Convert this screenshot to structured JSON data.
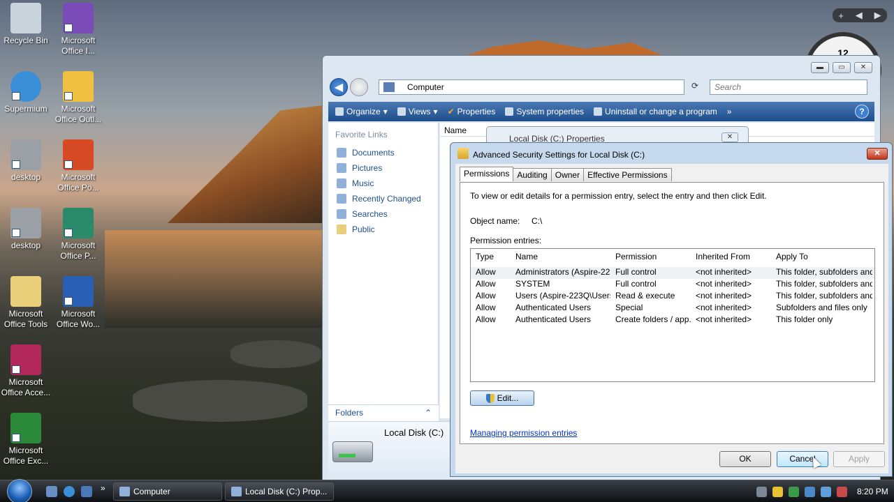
{
  "desktop": {
    "icons": [
      {
        "label": "Recycle Bin",
        "icon": "recycle-bin-icon",
        "color": "#c9d3dc"
      },
      {
        "label": "Microsoft Office I...",
        "icon": "office-infopath-icon",
        "color": "#7b4bb7"
      },
      {
        "label": "Supermium",
        "icon": "browser-globe-icon",
        "color": "#3a8fd6"
      },
      {
        "label": "Microsoft Office Outl...",
        "icon": "outlook-icon",
        "color": "#f0c040"
      },
      {
        "label": "desktop",
        "icon": "settings-gear-icon",
        "color": "#9aa0a6"
      },
      {
        "label": "Microsoft Office Po...",
        "icon": "powerpoint-icon",
        "color": "#d64a26"
      },
      {
        "label": "desktop",
        "icon": "settings-gear-icon",
        "color": "#9aa0a6"
      },
      {
        "label": "Microsoft Office P...",
        "icon": "publisher-icon",
        "color": "#2a8a6a"
      },
      {
        "label": "Microsoft Office Tools",
        "icon": "folder-icon",
        "color": "#e9cf79"
      },
      {
        "label": "Microsoft Office Wo...",
        "icon": "word-icon",
        "color": "#2b5fb4"
      },
      {
        "label": "Microsoft Office Acce...",
        "icon": "access-icon",
        "color": "#b2285b"
      },
      {
        "label": "Microsoft Office Exc...",
        "icon": "excel-icon",
        "color": "#2a8a3a"
      }
    ],
    "clock_gadget": "12",
    "gadget_controls": [
      "+",
      "◀",
      "▶"
    ]
  },
  "explorer": {
    "title_buttons": [
      "▬",
      "▭",
      "✕"
    ],
    "address": "Computer",
    "search_placeholder": "Search",
    "toolbar": {
      "organize": "Organize",
      "views": "Views",
      "properties": "Properties",
      "system_properties": "System properties",
      "uninstall": "Uninstall or change a program",
      "more": "»",
      "help": "?"
    },
    "favorite_links_title": "Favorite Links",
    "favorite_links": [
      "Documents",
      "Pictures",
      "Music",
      "Recently Changed",
      "Searches",
      "Public"
    ],
    "folders_label": "Folders",
    "column_name": "Name",
    "details_name": "Local Disk (C:)"
  },
  "properties_dialog": {
    "title": "Local Disk (C:) Properties"
  },
  "security_dialog": {
    "title": "Advanced Security Settings for Local Disk (C:)",
    "close": "✕",
    "tabs": [
      "Permissions",
      "Auditing",
      "Owner",
      "Effective Permissions"
    ],
    "instructions": "To view or edit details for a permission entry, select the entry and then click Edit.",
    "object_name_label": "Object name:",
    "object_name_value": "C:\\",
    "entries_label": "Permission entries:",
    "columns": [
      "Type",
      "Name",
      "Permission",
      "Inherited From",
      "Apply To"
    ],
    "rows": [
      {
        "type": "Allow",
        "name": "Administrators (Aspire-223...",
        "permission": "Full control",
        "inherited": "<not inherited>",
        "apply": "This folder, subfolders and..."
      },
      {
        "type": "Allow",
        "name": "SYSTEM",
        "permission": "Full control",
        "inherited": "<not inherited>",
        "apply": "This folder, subfolders and..."
      },
      {
        "type": "Allow",
        "name": "Users (Aspire-223Q\\Users)",
        "permission": "Read & execute",
        "inherited": "<not inherited>",
        "apply": "This folder, subfolders and..."
      },
      {
        "type": "Allow",
        "name": "Authenticated Users",
        "permission": "Special",
        "inherited": "<not inherited>",
        "apply": "Subfolders and files only"
      },
      {
        "type": "Allow",
        "name": "Authenticated Users",
        "permission": "Create folders / app...",
        "inherited": "<not inherited>",
        "apply": "This folder only"
      }
    ],
    "edit_button": "Edit...",
    "manage_link": "Managing permission entries",
    "ok": "OK",
    "cancel": "Cancel",
    "apply": "Apply"
  },
  "taskbar": {
    "buttons": [
      "Computer",
      "Local Disk (C:) Prop..."
    ],
    "quicklaunch_more": "»",
    "time": "8:20 PM"
  },
  "colors": {
    "accent": "#1d4e8b",
    "link": "#0033cc"
  }
}
